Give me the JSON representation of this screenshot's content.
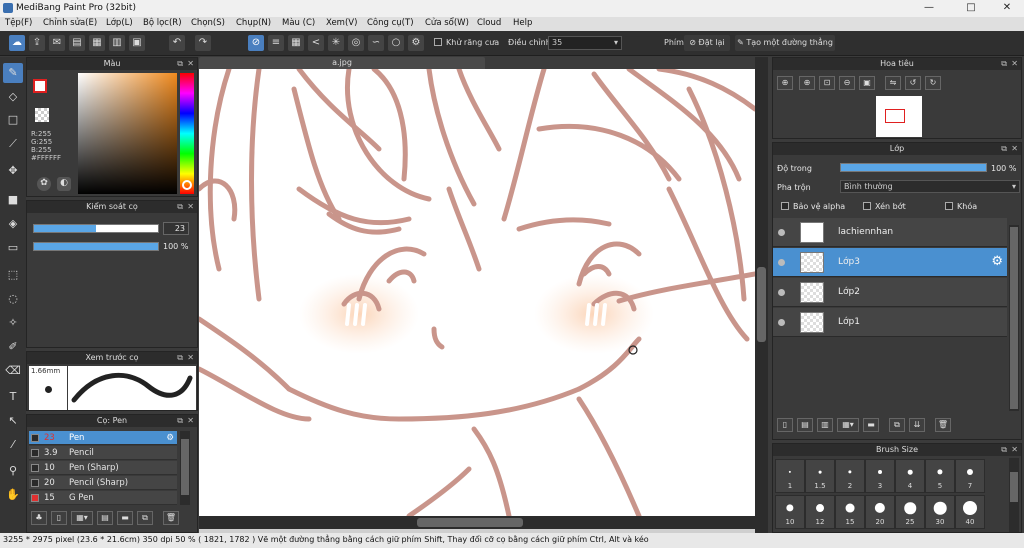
{
  "app": {
    "title": "MediBang Paint Pro (32bit)"
  },
  "menu": [
    "Tệp(F)",
    "Chỉnh sửa(E)",
    "Lớp(L)",
    "Bộ lọc(R)",
    "Chọn(S)",
    "Chụp(N)",
    "Màu (C)",
    "Xem(V)",
    "Công cụ(T)",
    "Cửa sổ(W)",
    "Cloud",
    "Help"
  ],
  "toolbar": {
    "antialias_label": "Khử răng cưa",
    "adjust_label": "Điều chỉnh",
    "adjust_value": "35",
    "key_label": "Phím",
    "reset_label": "Đặt lại",
    "line_label": "Tạo một đường thẳng"
  },
  "color_panel": {
    "title": "Màu",
    "r": "R:255",
    "g": "G:255",
    "b": "B:255",
    "hex": "#FFFFFF"
  },
  "brush_control": {
    "title": "Kiểm soát cọ",
    "size": "23",
    "size_fraction": 0.5,
    "opacity": "100 %",
    "opacity_fraction": 1.0
  },
  "brush_preview": {
    "title": "Xem trước cọ",
    "size": "1.66mm"
  },
  "brush_list": {
    "title": "Cọ: Pen",
    "items": [
      {
        "size": "23",
        "name": "Pen",
        "color": "#2a2a2a"
      },
      {
        "size": "3.9",
        "name": "Pencil",
        "color": "#2a2a2a"
      },
      {
        "size": "10",
        "name": "Pen (Sharp)",
        "color": "#2a2a2a"
      },
      {
        "size": "20",
        "name": "Pencil (Sharp)",
        "color": "#2a2a2a"
      },
      {
        "size": "15",
        "name": "G Pen",
        "color": "#e03030"
      }
    ]
  },
  "document": {
    "tab": "a.jpg"
  },
  "navigator": {
    "title": "Hoa tiêu"
  },
  "layers": {
    "title": "Lớp",
    "opacity_label": "Độ trong",
    "opacity_value": "100 %",
    "blend_label": "Pha trộn",
    "blend_value": "Bình thường",
    "protect_alpha": "Bảo vệ alpha",
    "clipping": "Xén bớt",
    "lock": "Khóa",
    "items": [
      "lachiennhan",
      "Lớp3",
      "Lớp2",
      "Lớp1"
    ],
    "selected": 1
  },
  "brush_size": {
    "title": "Brush Size",
    "row1": [
      "1",
      "1.5",
      "2",
      "3",
      "4",
      "5",
      "7"
    ],
    "row2": [
      "10",
      "12",
      "15",
      "20",
      "25",
      "30",
      "40"
    ]
  },
  "status": "3255 * 2975 pixel   (23.6 * 21.6cm)   350 dpi   50 %   ( 1821, 1782 )   Vẽ một đường thẳng bằng cách giữ phím Shift, Thay đổi cỡ cọ bằng cách giữ phím Ctrl, Alt và kéo",
  "colors": {
    "accent": "#4a90d0",
    "line": "#c9958b",
    "blush": "#fcd9c0"
  }
}
